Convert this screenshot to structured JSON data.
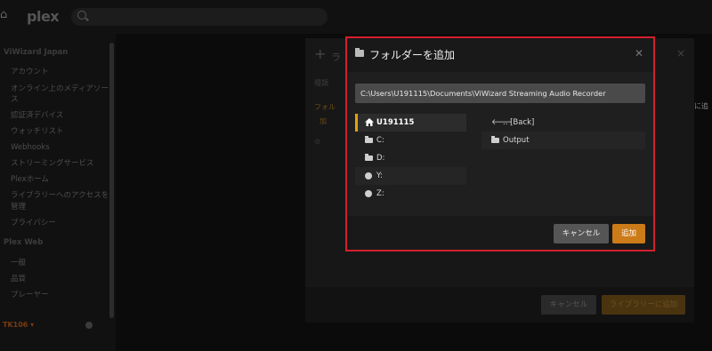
{
  "app": {
    "logo": "plex"
  },
  "sidebar": {
    "section1": "ViWizard Japan",
    "items1": [
      "アカウント",
      "オンライン上のメディアソー",
      "ス",
      "認証済デバイス",
      "ウォッチリスト",
      "Webhooks",
      "ストリーミングサービス",
      "Plexホーム",
      "ライブラリーへのアクセスを",
      "管理",
      "プライバシー"
    ],
    "section2": "Plex Web",
    "items2": [
      "一般",
      "品質",
      "プレーヤー"
    ],
    "server": "TK106 ▾"
  },
  "bg_dialog": {
    "title": "ラ",
    "row1": "種類",
    "row2": "フォル",
    "row3": "加",
    "cancel": "キャンセル",
    "add": "ライブラリーに追加",
    "side_text": "に追"
  },
  "modal": {
    "title": "フォルダーを追加",
    "path_value": "C:\\Users\\U191115\\Documents\\ViWizard Streaming Audio Recorder",
    "left_items": [
      {
        "label": "U191115",
        "icon": "home-icon"
      },
      {
        "label": "C:",
        "icon": "folder-icon"
      },
      {
        "label": "D:",
        "icon": "folder-icon"
      },
      {
        "label": "Y:",
        "icon": "globe-icon"
      },
      {
        "label": "Z:",
        "icon": "globe-icon"
      }
    ],
    "right_items": [
      {
        "label": ".. [Back]",
        "icon": "arrow-left-icon"
      },
      {
        "label": "Output",
        "icon": "folder-icon"
      }
    ],
    "cancel": "キャンセル",
    "add": "追加",
    "accent": "#cc7b19",
    "highlight": "#d3202d"
  }
}
